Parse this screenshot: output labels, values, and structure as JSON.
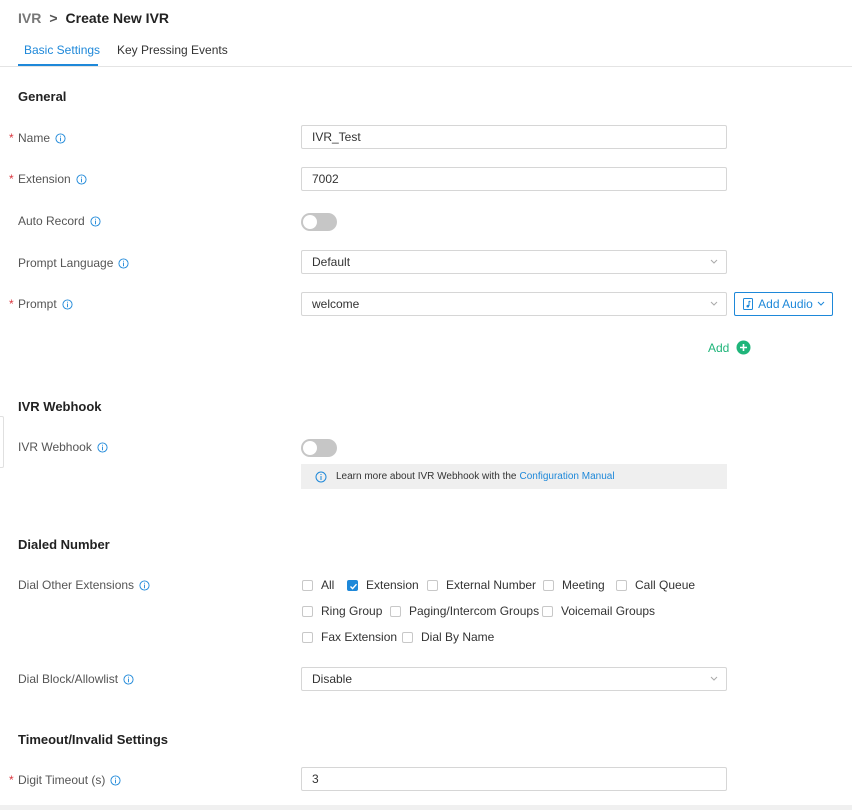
{
  "breadcrumb": {
    "root": "IVR",
    "separator": ">",
    "current": "Create New IVR"
  },
  "tabs": [
    {
      "label": "Basic Settings",
      "active": true
    },
    {
      "label": "Key Pressing Events",
      "active": false
    }
  ],
  "general": {
    "title": "General",
    "name": {
      "label": "Name",
      "value": "IVR_Test",
      "required": true
    },
    "extension": {
      "label": "Extension",
      "value": "7002",
      "required": true
    },
    "auto_record": {
      "label": "Auto Record",
      "enabled": false
    },
    "prompt_language": {
      "label": "Prompt Language",
      "value": "Default"
    },
    "prompt": {
      "label": "Prompt",
      "value": "welcome",
      "required": true
    },
    "add_audio_label": "Add Audio",
    "add_label": "Add"
  },
  "webhook": {
    "title": "IVR Webhook",
    "toggle_label": "IVR Webhook",
    "enabled": false,
    "notice_text": "Learn more about IVR Webhook with the",
    "notice_link": "Configuration Manual"
  },
  "dialed_number": {
    "title": "Dialed Number",
    "dial_other_label": "Dial Other Extensions",
    "options": [
      {
        "label": "All",
        "checked": false
      },
      {
        "label": "Extension",
        "checked": true
      },
      {
        "label": "External Number",
        "checked": false
      },
      {
        "label": "Meeting",
        "checked": false
      },
      {
        "label": "Call Queue",
        "checked": false
      },
      {
        "label": "Ring Group",
        "checked": false
      },
      {
        "label": "Paging/Intercom Groups",
        "checked": false
      },
      {
        "label": "Voicemail Groups",
        "checked": false
      },
      {
        "label": "Fax Extension",
        "checked": false
      },
      {
        "label": "Dial By Name",
        "checked": false
      }
    ],
    "block_allow_label": "Dial Block/Allowlist",
    "block_allow_value": "Disable"
  },
  "timeout": {
    "title": "Timeout/Invalid Settings",
    "digit_timeout_label": "Digit Timeout (s)",
    "digit_timeout_value": "3"
  },
  "colors": {
    "accent": "#1e88d9",
    "success": "#1fb57a",
    "required": "#d9363e"
  }
}
